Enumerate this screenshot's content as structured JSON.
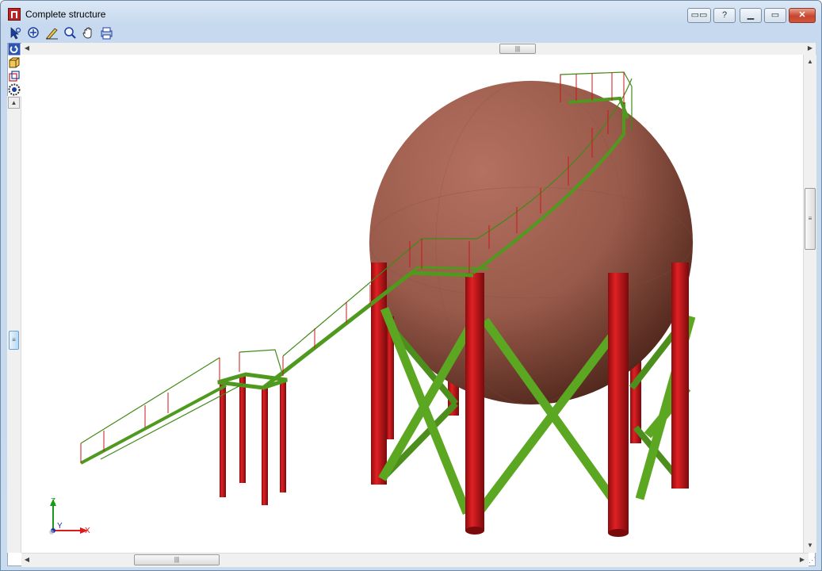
{
  "window": {
    "title": "Complete structure",
    "buttons": {
      "view": "▭▭",
      "help": "?",
      "minimize": "▁",
      "maximize": "▭",
      "close": "✕"
    }
  },
  "toolbar": {
    "icons": [
      "select-arrow-icon",
      "zoom-window-icon",
      "pen-icon",
      "zoom-icon",
      "pan-hand-icon",
      "print-icon"
    ]
  },
  "left_toolbar": {
    "icons": [
      "rotate-icon",
      "cube-icon",
      "box-view-icon",
      "eye-settings-icon"
    ]
  },
  "scrollbars": {
    "thumb_grip": "|||"
  },
  "axes": {
    "z": "Z",
    "y": "Y",
    "x": "X"
  },
  "colors": {
    "sphere": "#9d5b4b",
    "columns": "#d4181c",
    "bracing": "#5aa520",
    "railing_post": "#c81919"
  }
}
